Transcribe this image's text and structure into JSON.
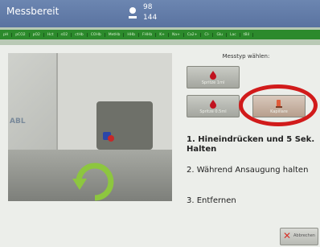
{
  "top_bar": {
    "status_title": "Messbereit",
    "counter_a": "98",
    "counter_b": "144"
  },
  "parameter_strip": [
    "pH",
    "pCO2",
    "pO2",
    "Hct",
    "sO2",
    "ctHb",
    "COHb",
    "MetHb",
    "HHb",
    "FHHb",
    "K+",
    "Na+",
    "Ca2+",
    "Cl-",
    "Glu",
    "Lac",
    "tBil"
  ],
  "main": {
    "measurement_type_label": "Messtyp wählen:",
    "photo_brand_text": "ABL",
    "buttons": {
      "syringe_top": "Spritze 1ml",
      "syringe_bottom": "Spritze 0.5ml",
      "capillary": "Kapillare"
    },
    "steps": [
      "1. Hineindrücken und 5 Sek. Halten",
      "2. Während Ansaugung halten",
      "3. Entfernen"
    ],
    "cancel_label": "Abbrechen"
  },
  "colors": {
    "top_bar": "#5f78a6",
    "param_strip": "#2c8a2c",
    "highlight": "#d11b1b",
    "arrow": "#8dc63f"
  }
}
